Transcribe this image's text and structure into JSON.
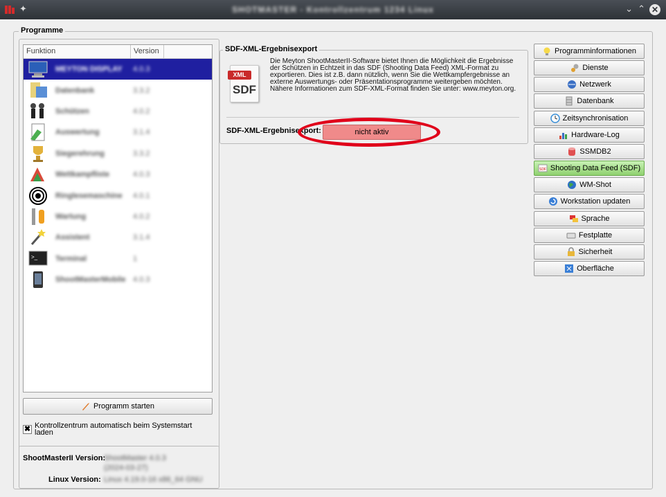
{
  "window": {
    "title": "SHOTMASTER - Kontrollzentrum 1234 Linux",
    "controls": [
      "⌄",
      "⌃"
    ]
  },
  "programme": {
    "group_title": "Programme",
    "columns": [
      "Funktion",
      "Version"
    ],
    "rows": [
      {
        "name": "MEYTON DISPLAY",
        "version": "4.0.3",
        "icon": "computer-icon",
        "selected": true
      },
      {
        "name": "Datenbank",
        "version": "3.3.2",
        "icon": "database-icon"
      },
      {
        "name": "Schützen",
        "version": "4.0.2",
        "icon": "shooters-icon"
      },
      {
        "name": "Auswertung",
        "version": "3.1.4",
        "icon": "report-icon"
      },
      {
        "name": "Siegerehrung",
        "version": "3.3.2",
        "icon": "trophy-icon"
      },
      {
        "name": "Wettkampfliste",
        "version": "4.0.3",
        "icon": "recycle-icon"
      },
      {
        "name": "Ringlesemaschine",
        "version": "4.0.1",
        "icon": "target-icon"
      },
      {
        "name": "Wartung",
        "version": "4.0.2",
        "icon": "tools-icon"
      },
      {
        "name": "Assistent",
        "version": "3.1.4",
        "icon": "wand-icon"
      },
      {
        "name": "Terminal",
        "version": "1",
        "icon": "terminal-icon"
      },
      {
        "name": "ShootMasterMobile",
        "version": "4.0.3",
        "icon": "mobile-icon"
      }
    ],
    "start_button": "Programm starten",
    "autostart_label": "Kontrollzentrum automatisch beim Systemstart laden",
    "autostart_checked": true,
    "shootmaster_version_label": "ShootMasterII Version:",
    "shootmaster_version_line1": "ShootMaster 4.0.3",
    "shootmaster_version_line2": "(2024-03-27)",
    "linux_version_label": "Linux Version:",
    "linux_version_value": "Linux 4.19.0-16 x86_64 GNU"
  },
  "sdf": {
    "group_title": "SDF-XML-Ergebnisexport",
    "icon_top": "XML",
    "icon_bottom": "SDF",
    "description": "Die Meyton ShootMasterII-Software bietet Ihnen die Möglichkeit die Ergebnisse der Schützen in Echtzeit in das SDF (Shooting Data Feed) XML-Format zu exportieren. Dies ist z.B. dann nützlich, wenn Sie die Wettkampfergebnisse an externe Auswertungs- oder Präsentationsprogramme weitergeben möchten. Nähere Informationen zum SDF-XML-Format finden Sie unter: www.meyton.org.",
    "status_label": "SDF-XML-Ergebnisexport:",
    "status_value": "nicht aktiv",
    "status_color": "#f08a8a"
  },
  "nav": {
    "items": [
      {
        "label": "Programminformationen",
        "icon": "lightbulb-icon"
      },
      {
        "label": "Dienste",
        "icon": "gears-icon"
      },
      {
        "label": "Netzwerk",
        "icon": "network-icon"
      },
      {
        "label": "Datenbank",
        "icon": "database-icon"
      },
      {
        "label": "Zeitsynchronisation",
        "icon": "clock-icon"
      },
      {
        "label": "Hardware-Log",
        "icon": "chart-icon"
      },
      {
        "label": "SSMDB2",
        "icon": "db-red-icon"
      },
      {
        "label": "Shooting Data Feed (SDF)",
        "icon": "sdf-icon",
        "active": true
      },
      {
        "label": "WM-Shot",
        "icon": "globe-icon"
      },
      {
        "label": "Workstation updaten",
        "icon": "update-icon"
      },
      {
        "label": "Sprache",
        "icon": "flags-icon"
      },
      {
        "label": "Festplatte",
        "icon": "disk-icon"
      },
      {
        "label": "Sicherheit",
        "icon": "lock-icon"
      },
      {
        "label": "Oberfläche",
        "icon": "desktop-icon"
      }
    ],
    "active_color": "#8fd16f"
  }
}
